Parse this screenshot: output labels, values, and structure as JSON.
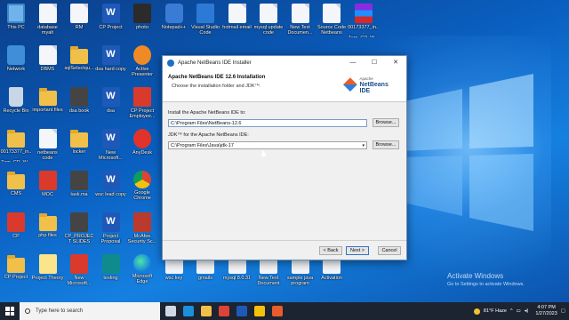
{
  "desktop": {
    "icons": [
      {
        "label": "This PC",
        "kind": "pc"
      },
      {
        "label": "database myalt",
        "kind": "doc"
      },
      {
        "label": "RM",
        "kind": "doc"
      },
      {
        "label": "CP Project",
        "kind": "word"
      },
      {
        "label": "photo",
        "kind": "photo"
      },
      {
        "label": "Notepad++",
        "kind": "exe"
      },
      {
        "label": "Visual Studio Code",
        "kind": "vscode"
      },
      {
        "label": "hotmail email",
        "kind": "doc"
      },
      {
        "label": "mysql update code",
        "kind": "doc"
      },
      {
        "label": "New Text Documen...",
        "kind": "doc"
      },
      {
        "label": "Source Code Netbeans",
        "kind": "doc"
      },
      {
        "label": "00173377_in... Zam_CP_W...",
        "kind": "rar"
      },
      {
        "label": "Network",
        "kind": "net"
      },
      {
        "label": "DBMS",
        "kind": "doc"
      },
      {
        "label": "sqlSelectqu...",
        "kind": "folder"
      },
      {
        "label": "dsa hard copy",
        "kind": "word"
      },
      {
        "label": "Active Presenter",
        "kind": "orange"
      },
      {
        "label": "Recycle Bin",
        "kind": "recycle"
      },
      {
        "label": "important files",
        "kind": "folder"
      },
      {
        "label": "dsa book",
        "kind": "dark"
      },
      {
        "label": "dsa",
        "kind": "word"
      },
      {
        "label": "CP Project Employee...",
        "kind": "pdf"
      },
      {
        "label": "00173377_in... Zam_CP_W...",
        "kind": "folder"
      },
      {
        "label": "netbeans code",
        "kind": "doc"
      },
      {
        "label": "locker",
        "kind": "folder"
      },
      {
        "label": "New Microsoft...",
        "kind": "word"
      },
      {
        "label": "AnyDesk",
        "kind": "red"
      },
      {
        "label": "CMS",
        "kind": "folder"
      },
      {
        "label": "MOC",
        "kind": "pdf"
      },
      {
        "label": "task.ma",
        "kind": "dark"
      },
      {
        "label": "wsc lead copy",
        "kind": "word"
      },
      {
        "label": "Google Chrome",
        "kind": "chrome"
      },
      {
        "label": "CP",
        "kind": "pdf"
      },
      {
        "label": "php files",
        "kind": "folder"
      },
      {
        "label": "CP_PROJECT SLIDES",
        "kind": "dark"
      },
      {
        "label": "Project Proposal",
        "kind": "word"
      },
      {
        "label": "McAfee Security Sc...",
        "kind": "sql"
      },
      {
        "label": "CP Project",
        "kind": "folder"
      },
      {
        "label": "Project Theory",
        "kind": "yellowdoc"
      },
      {
        "label": "New Microsoft...",
        "kind": "pdf"
      },
      {
        "label": "testing",
        "kind": "teal"
      },
      {
        "label": "Microsoft Edge",
        "kind": "edge"
      },
      {
        "label": "wsc key",
        "kind": "doc"
      },
      {
        "label": "gmails",
        "kind": "doc"
      },
      {
        "label": "mysql 8.0.31",
        "kind": "doc"
      },
      {
        "label": "New Text Document",
        "kind": "doc"
      },
      {
        "label": "sample java program",
        "kind": "doc"
      },
      {
        "label": "Activation",
        "kind": "doc"
      }
    ]
  },
  "installer": {
    "window_title": "Apache NetBeans IDE Installer",
    "header_title": "Apache NetBeans IDE 12.6 Installation",
    "header_subtitle": "Choose the installation folder and JDK™.",
    "logo_small": "Apache",
    "logo_big": "NetBeans IDE",
    "install_label": "Install the Apache NetBeans IDE to:",
    "install_path": "C:\\Program Files\\NetBeans-12.6",
    "jdk_label": "JDK™ for the Apache NetBeans IDE:",
    "jdk_path": "C:\\Program Files\\Java\\jdk-17",
    "browse_label": "Browse...",
    "back_label": "< Back",
    "next_label": "Next >",
    "cancel_label": "Cancel",
    "minimize": "—",
    "maximize": "☐",
    "close": "✕"
  },
  "activation": {
    "title": "Activate Windows",
    "subtitle": "Go to Settings to activate Windows."
  },
  "taskbar": {
    "search_placeholder": "Type here to search",
    "weather": "81°F  Haze",
    "time": "4:07 PM",
    "date": "1/27/2023",
    "pinned": [
      {
        "name": "task-view-icon",
        "color": "#cfd8e3"
      },
      {
        "name": "edge-taskbar-icon",
        "color": "#1b8fdc"
      },
      {
        "name": "file-explorer-icon",
        "color": "#f1c04a"
      },
      {
        "name": "chrome-taskbar-icon",
        "color": "#db4437"
      },
      {
        "name": "word-taskbar-icon",
        "color": "#1e59b8"
      },
      {
        "name": "chrome-alt-taskbar-icon",
        "color": "#f4c20d"
      },
      {
        "name": "netbeans-taskbar-icon",
        "color": "#e85d2a"
      }
    ]
  }
}
